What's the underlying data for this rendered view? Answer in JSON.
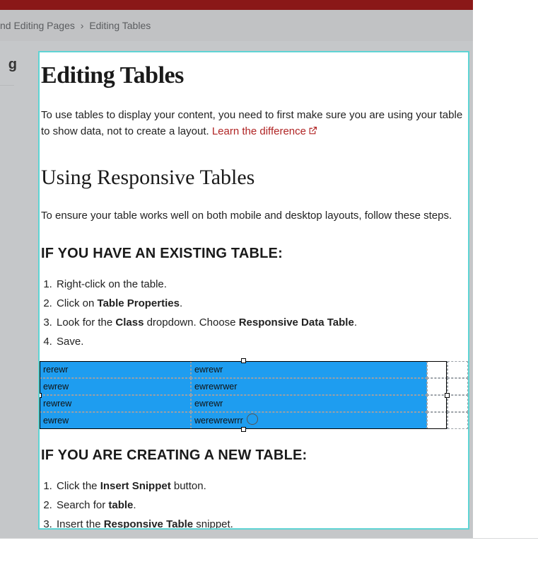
{
  "breadcrumb": {
    "part1": "nd Editing Pages",
    "sep": "›",
    "part2": "Editing Tables"
  },
  "side_fragment": "g",
  "page_title": "Editing Tables",
  "intro": {
    "text_before": "To use tables to display your content, you need to first make sure you are using your table to show data, not to create a layout. ",
    "link_text": "Learn the difference"
  },
  "section2_title": "Using Responsive Tables",
  "section2_intro": "To ensure your table works well on both mobile and desktop layouts, follow these steps.",
  "existing_heading": "IF YOU HAVE AN EXISTING TABLE:",
  "existing_steps": [
    {
      "pre": "Right-click on the table.",
      "b1": "",
      "mid": "",
      "b2": "",
      "post": ""
    },
    {
      "pre": "Click on ",
      "b1": "Table Properties",
      "mid": "",
      "b2": "",
      "post": "."
    },
    {
      "pre": "Look for the ",
      "b1": "Class",
      "mid": " dropdown. Choose ",
      "b2": "Responsive Data Table",
      "post": "."
    },
    {
      "pre": "Save.",
      "b1": "",
      "mid": "",
      "b2": "",
      "post": ""
    }
  ],
  "table_sample": {
    "rows": [
      [
        "rerewr",
        "ewrewr",
        "",
        ""
      ],
      [
        "ewrew",
        "ewrewrwer",
        "",
        ""
      ],
      [
        "rewrew",
        "ewrewr",
        "",
        ""
      ],
      [
        "ewrew",
        "werewrewrrr",
        "",
        ""
      ]
    ]
  },
  "new_heading": "IF YOU ARE CREATING A NEW TABLE:",
  "new_steps": [
    {
      "pre": "Click the ",
      "b1": "Insert Snippet",
      "mid": "",
      "b2": "",
      "post": " button."
    },
    {
      "pre": "Search for ",
      "b1": "table",
      "mid": "",
      "b2": "",
      "post": "."
    },
    {
      "pre": "Insert the ",
      "b1": "Responsive Table",
      "mid": "",
      "b2": "",
      "post": " snippet."
    }
  ]
}
